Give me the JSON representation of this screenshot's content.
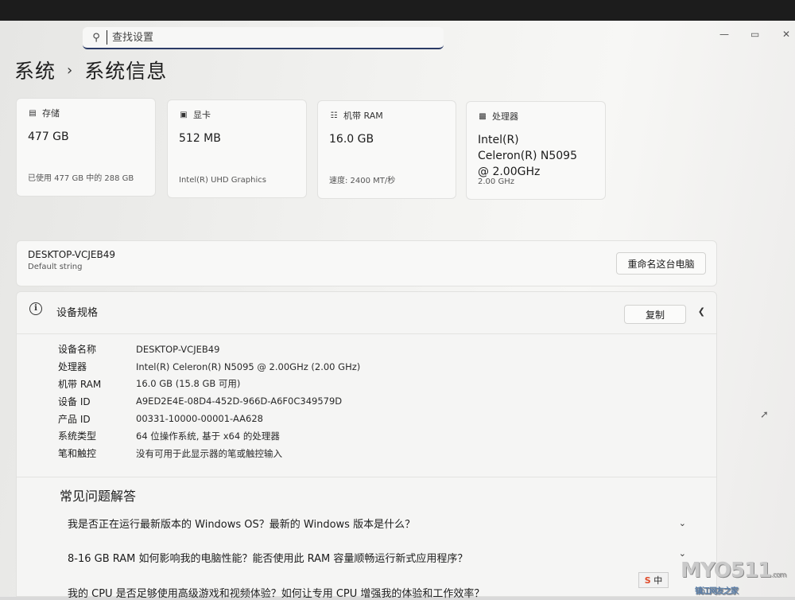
{
  "search": {
    "placeholder": "查找设置",
    "icon": "search-icon"
  },
  "window_controls": {
    "minimize": "—",
    "maximize": "▭",
    "close": "✕"
  },
  "breadcrumb": {
    "parent": "系统",
    "separator": "›",
    "current": "系统信息"
  },
  "cards": [
    {
      "label": "存储",
      "icon": "storage-icon",
      "value": "477 GB",
      "sub": "已使用 477 GB 中的 288 GB"
    },
    {
      "label": "显卡",
      "icon": "graphics-card-icon",
      "value": "512 MB",
      "sub": "Intel(R) UHD Graphics"
    },
    {
      "label": "机带 RAM",
      "icon": "ram-icon",
      "value": "16.0 GB",
      "sub": "速度: 2400 MT/秒"
    },
    {
      "label": "处理器",
      "icon": "processor-icon",
      "value": "Intel(R) Celeron(R) N5095 @ 2.00GHz",
      "sub": "2.00 GHz"
    }
  ],
  "pc": {
    "name": "DESKTOP-VCJEB49",
    "sub": "Default string",
    "rename_label": "重命名这台电脑"
  },
  "specs": {
    "title": "设备规格",
    "copy_label": "复制",
    "rows": [
      {
        "key": "设备名称",
        "value": "DESKTOP-VCJEB49"
      },
      {
        "key": "处理器",
        "value": "Intel(R) Celeron(R) N5095 @ 2.00GHz (2.00 GHz)"
      },
      {
        "key": "机带 RAM",
        "value": "16.0 GB (15.8 GB 可用)"
      },
      {
        "key": "设备 ID",
        "value": "A9ED2E4E-08D4-452D-966D-A6F0C349579D"
      },
      {
        "key": "产品 ID",
        "value": "00331-10000-00001-AA628"
      },
      {
        "key": "系统类型",
        "value": "64 位操作系统, 基于 x64 的处理器"
      },
      {
        "key": "笔和触控",
        "value": "没有可用于此显示器的笔或触控输入"
      }
    ]
  },
  "faq": {
    "title": "常见问题解答",
    "items": [
      "我是否正在运行最新版本的 Windows OS？最新的 Windows 版本是什么？",
      "8-16 GB RAM 如何影响我的电脑性能？能否使用此 RAM 容量顺畅运行新式应用程序？",
      "我的 CPU 是否足够使用高级游戏和视频体验？如何让专用 CPU 增强我的体验和工作效率？"
    ]
  },
  "watermark": {
    "text": "MYO511",
    "suffix": ".com",
    "sub": "镇江网友之家"
  },
  "tray": {
    "ime": "S",
    "mode": "中"
  }
}
